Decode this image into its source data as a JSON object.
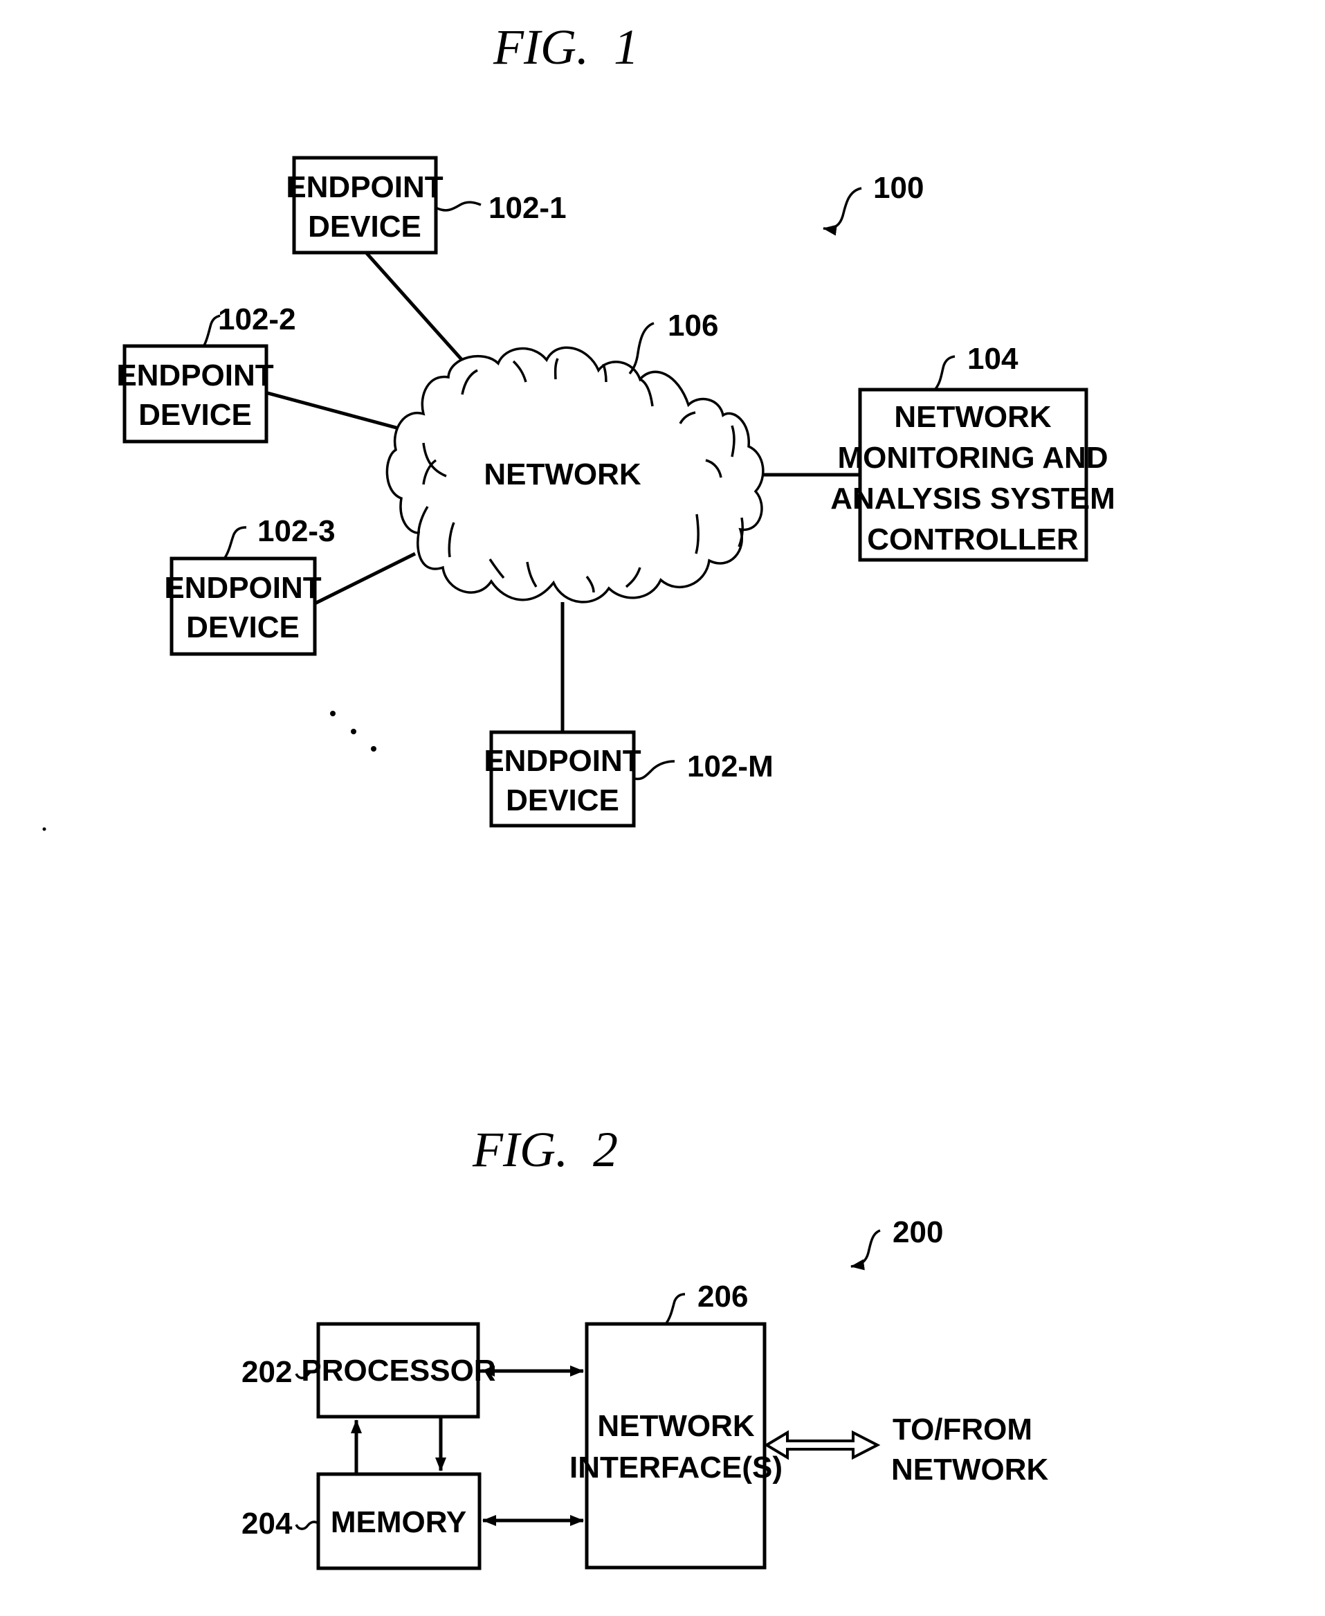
{
  "page": {
    "background_color": "#ffffff",
    "ink_color": "#000000"
  },
  "fig1": {
    "title": "FIG.  1",
    "system_ref": "100",
    "network": {
      "label": "NETWORK",
      "ref": "106"
    },
    "controller": {
      "ref": "104",
      "lines": [
        "NETWORK",
        "MONITORING AND",
        "ANALYSIS SYSTEM",
        "CONTROLLER"
      ]
    },
    "endpoints": [
      {
        "ref": "102-1",
        "lines": [
          "ENDPOINT",
          "DEVICE"
        ]
      },
      {
        "ref": "102-2",
        "lines": [
          "ENDPOINT",
          "DEVICE"
        ]
      },
      {
        "ref": "102-3",
        "lines": [
          "ENDPOINT",
          "DEVICE"
        ]
      },
      {
        "ref": "102-M",
        "lines": [
          "ENDPOINT",
          "DEVICE"
        ]
      }
    ],
    "ellipsis_icon": "vertical-ellipsis-dots"
  },
  "fig2": {
    "title": "FIG.  2",
    "system_ref": "200",
    "processor": {
      "ref": "202",
      "label": "PROCESSOR"
    },
    "memory": {
      "ref": "204",
      "label": "MEMORY"
    },
    "network_interface": {
      "ref": "206",
      "lines": [
        "NETWORK",
        "INTERFACE(S)"
      ]
    },
    "external": {
      "lines": [
        "TO/FROM",
        "NETWORK"
      ]
    }
  }
}
